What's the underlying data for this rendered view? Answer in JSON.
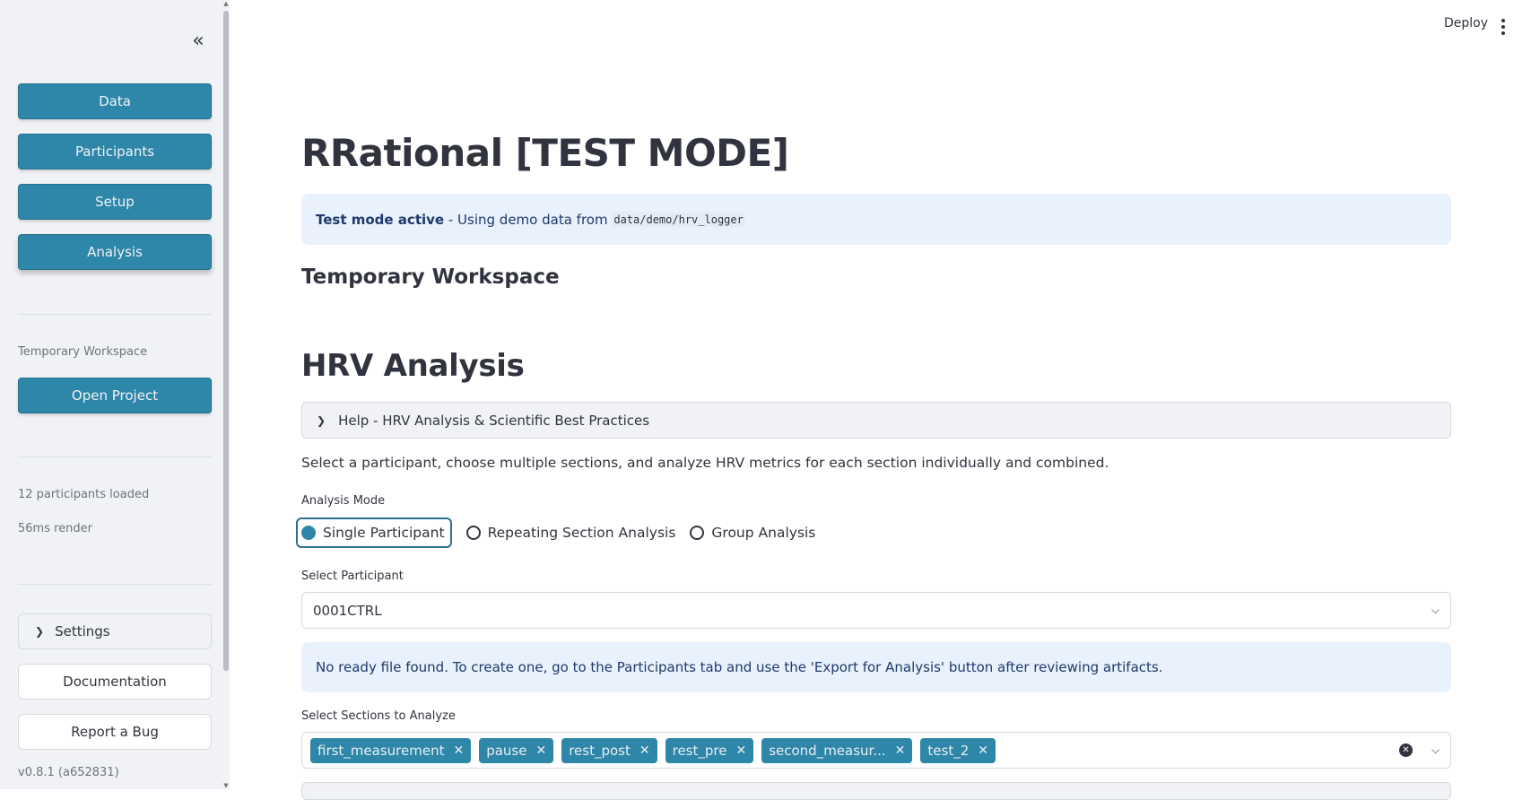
{
  "sidebar": {
    "nav": [
      {
        "label": "Data"
      },
      {
        "label": "Participants"
      },
      {
        "label": "Setup"
      },
      {
        "label": "Analysis"
      }
    ],
    "workspace_label": "Temporary Workspace",
    "open_project_label": "Open Project",
    "participants_loaded": "12 participants loaded",
    "render_time": "56ms render",
    "settings_label": "Settings",
    "documentation_label": "Documentation",
    "report_bug_label": "Report a Bug",
    "version": "v0.8.1 (a652831)"
  },
  "header": {
    "deploy_label": "Deploy"
  },
  "main": {
    "title": "RRational [TEST MODE]",
    "test_mode": {
      "bold": "Test mode active",
      "text": " - Using demo data from ",
      "path": "data/demo/hrv_logger"
    },
    "workspace_subheader": "Temporary Workspace",
    "section_title": "HRV Analysis",
    "help_label": "Help - HRV Analysis & Scientific Best Practices",
    "description": "Select a participant, choose multiple sections, and analyze HRV metrics for each section individually and combined.",
    "analysis_mode": {
      "label": "Analysis Mode",
      "options": [
        "Single Participant",
        "Repeating Section Analysis",
        "Group Analysis"
      ],
      "selected": "Single Participant"
    },
    "participant_select": {
      "label": "Select Participant",
      "value": "0001CTRL"
    },
    "ready_info": "No ready file found. To create one, go to the Participants tab and use the 'Export for Analysis' button after reviewing artifacts.",
    "sections_select": {
      "label": "Select Sections to Analyze",
      "tags": [
        "first_measurement",
        "pause",
        "rest_post",
        "rest_pre",
        "second_measur...",
        "test_2"
      ]
    }
  },
  "colors": {
    "primary": "#2e86a8",
    "sidebar_bg": "#f0f2f6",
    "info_bg": "#e8f1fc",
    "text": "#31333f"
  }
}
